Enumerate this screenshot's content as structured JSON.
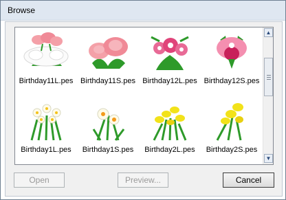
{
  "window": {
    "title": "Browse"
  },
  "files": [
    {
      "name": "Birthday11L.pes",
      "thumb": "peony-white-icon"
    },
    {
      "name": "Birthday11S.pes",
      "thumb": "peony-pink-icon"
    },
    {
      "name": "Birthday12L.pes",
      "thumb": "orchid-bouquet-icon"
    },
    {
      "name": "Birthday12S.pes",
      "thumb": "orchid-icon"
    },
    {
      "name": "Birthday1L.pes",
      "thumb": "narcissus-bouquet-icon"
    },
    {
      "name": "Birthday1S.pes",
      "thumb": "narcissus-icon"
    },
    {
      "name": "Birthday2L.pes",
      "thumb": "freesia-bouquet-icon"
    },
    {
      "name": "Birthday2S.pes",
      "thumb": "freesia-icon"
    }
  ],
  "buttons": {
    "open": {
      "label": "Open",
      "enabled": false
    },
    "preview": {
      "label": "Preview...",
      "enabled": false
    },
    "cancel": {
      "label": "Cancel",
      "enabled": true
    }
  },
  "scrollbar": {
    "up_icon": "▲",
    "down_icon": "▼"
  },
  "colors": {
    "peony_pink": "#f4a0a8",
    "orchid_pink": "#e0447a",
    "freesia_yellow": "#f2e21a",
    "leaf_green": "#2e9a2a"
  }
}
